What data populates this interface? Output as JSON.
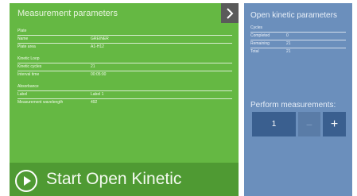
{
  "left_panel": {
    "title": "Measurement parameters",
    "plate_section": "Plate",
    "plate_rows": [
      {
        "key": "Name",
        "value": "GREINER"
      },
      {
        "key": "Plate area",
        "value": "A1-H12"
      }
    ],
    "kinetic_section": "Kinetic Loop",
    "kinetic_rows": [
      {
        "key": "Kinetic cycles",
        "value": "21"
      },
      {
        "key": "Interval time",
        "value": "00:05:00"
      }
    ],
    "absorbance_section": "Absorbance",
    "absorbance_rows": [
      {
        "key": "Label",
        "value": "Label 1"
      },
      {
        "key": "Measurement wavelength",
        "value": "492"
      }
    ],
    "start_label": "Start Open Kinetic",
    "colors": {
      "panel": "#65b843",
      "start_bar": "#4f9a33"
    }
  },
  "right_panel": {
    "title": "Open kinetic parameters",
    "cycles_section": "Cycles",
    "cycles_rows": [
      {
        "key": "Completed",
        "value": "0"
      },
      {
        "key": "Remaining",
        "value": "21"
      },
      {
        "key": "Total",
        "value": "21"
      }
    ],
    "perform_label": "Perform measurements:",
    "count_value": "1",
    "minus_symbol": "−",
    "plus_symbol": "+",
    "colors": {
      "panel": "#6b8fbc",
      "control": "#3a5f8f"
    }
  },
  "icons": {
    "next": "chevron-right-icon",
    "start": "play-circle-icon"
  }
}
